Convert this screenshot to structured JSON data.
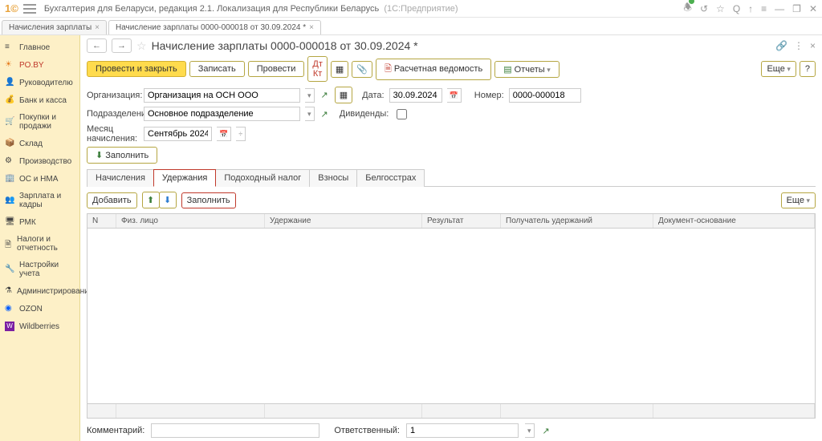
{
  "titlebar": {
    "app_name": "Бухгалтерия для Беларуси, редакция 2.1. Локализация для Республики Беларусь",
    "platform": "(1С:Предприятие)"
  },
  "window_tabs": [
    {
      "label": "Начисления зарплаты"
    },
    {
      "label": "Начисление зарплаты 0000-000018 от 30.09.2024 *"
    }
  ],
  "sidebar": {
    "items": [
      "Главное",
      "PO.BY",
      "Руководителю",
      "Банк и касса",
      "Покупки и продажи",
      "Склад",
      "Производство",
      "ОС и НМА",
      "Зарплата и кадры",
      "РМК",
      "Налоги и отчетность",
      "Настройки учета",
      "Администрирование",
      "OZON",
      "Wildberries"
    ]
  },
  "doc": {
    "title": "Начисление зарплаты 0000-000018 от 30.09.2024 *",
    "toolbar": {
      "post_close": "Провести и закрыть",
      "write": "Записать",
      "post": "Провести",
      "payslip": "Расчетная ведомость",
      "reports": "Отчеты",
      "more": "Еще"
    },
    "fields": {
      "org_label": "Организация:",
      "org_value": "Организация на ОСН ООО",
      "date_label": "Дата:",
      "date_value": "30.09.2024",
      "number_label": "Номер:",
      "number_value": "0000-000018",
      "division_label": "Подразделение:",
      "division_value": "Основное подразделение",
      "dividends_label": "Дивиденды:",
      "month_label": "Месяц начисления:",
      "month_value": "Сентябрь 2024",
      "fill": "Заполнить"
    },
    "subtabs": [
      "Начисления",
      "Удержания",
      "Подоходный налог",
      "Взносы",
      "Белгосстрах"
    ],
    "subtoolbar": {
      "add": "Добавить",
      "fill": "Заполнить",
      "more": "Еще"
    },
    "columns": {
      "n": "N",
      "person": "Физ. лицо",
      "deduction": "Удержание",
      "result": "Результат",
      "recipient": "Получатель удержаний",
      "basis": "Документ-основание"
    },
    "bottom": {
      "comment_label": "Комментарий:",
      "comment_value": "",
      "responsible_label": "Ответственный:",
      "responsible_value": "1"
    }
  },
  "help": "?"
}
